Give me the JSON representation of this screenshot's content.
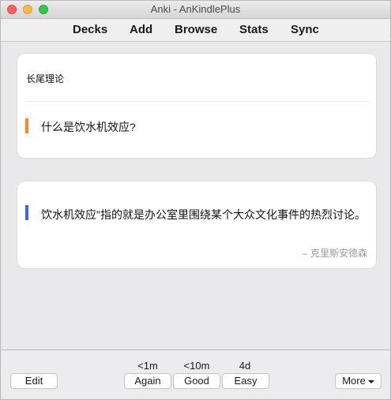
{
  "window": {
    "title": "Anki - AnKindlePlus"
  },
  "nav": {
    "decks": "Decks",
    "add": "Add",
    "browse": "Browse",
    "stats": "Stats",
    "sync": "Sync"
  },
  "question_card": {
    "deck_name": "长尾理论",
    "question": "什么是饮水机效应?",
    "accent_color": "#f0892a"
  },
  "answer_card": {
    "answer": "饮水机效应\"指的就是办公室里围绕某个大众文化事件的热烈讨论。",
    "source": "– 克里斯安德森",
    "accent_color": "#3f67e0"
  },
  "bottom": {
    "edit_label": "Edit",
    "again_interval": "<1m",
    "again_label": "Again",
    "good_interval": "<10m",
    "good_label": "Good",
    "easy_interval": "4d",
    "easy_label": "Easy",
    "more_label": "More"
  },
  "icons": {
    "close": "close-traffic-light",
    "minimize": "minimize-traffic-light",
    "zoom": "zoom-traffic-light",
    "more_dropdown": "chevron-down-icon"
  }
}
